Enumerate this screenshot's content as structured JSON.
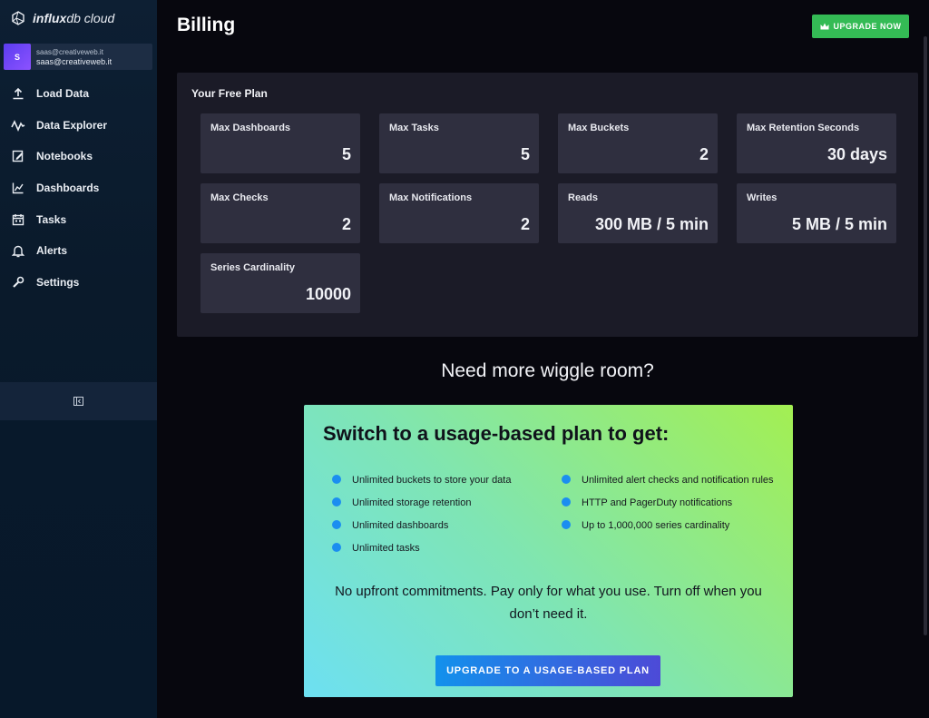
{
  "app": {
    "logo_text_bold": "influx",
    "logo_text_rest": "db cloud"
  },
  "user": {
    "avatar_letter": "S",
    "line1": "saas@creativeweb.it",
    "line2": "saas@creativeweb.it"
  },
  "sidebar": {
    "items": [
      {
        "label": "Load Data",
        "icon": "upload-icon"
      },
      {
        "label": "Data Explorer",
        "icon": "graph-icon"
      },
      {
        "label": "Notebooks",
        "icon": "notebook-icon"
      },
      {
        "label": "Dashboards",
        "icon": "dashboard-icon"
      },
      {
        "label": "Tasks",
        "icon": "calendar-icon"
      },
      {
        "label": "Alerts",
        "icon": "bell-icon"
      },
      {
        "label": "Settings",
        "icon": "wrench-icon"
      }
    ]
  },
  "header": {
    "title": "Billing",
    "upgrade_label": "UPGRADE NOW"
  },
  "plan": {
    "title": "Your Free Plan",
    "cards": [
      {
        "label": "Max Dashboards",
        "value": "5"
      },
      {
        "label": "Max Tasks",
        "value": "5"
      },
      {
        "label": "Max Buckets",
        "value": "2"
      },
      {
        "label": "Max Retention Seconds",
        "value": "30 days"
      },
      {
        "label": "Max Checks",
        "value": "2"
      },
      {
        "label": "Max Notifications",
        "value": "2"
      },
      {
        "label": "Reads",
        "value": "300 MB / 5 min"
      },
      {
        "label": "Writes",
        "value": "5 MB / 5 min"
      },
      {
        "label": "Series Cardinality",
        "value": "10000"
      }
    ]
  },
  "promo": {
    "heading": "Need more wiggle room?",
    "title": "Switch to a usage-based plan to get:",
    "features_left": [
      "Unlimited buckets to store your data",
      "Unlimited storage retention",
      "Unlimited dashboards",
      "Unlimited tasks"
    ],
    "features_right": [
      "Unlimited alert checks and notification rules",
      "HTTP and PagerDuty notifications",
      "Up to 1,000,000 series cardinality"
    ],
    "note": "No upfront commitments. Pay only for what you use. Turn off when you don’t need it.",
    "button_label": "UPGRADE TO A USAGE-BASED PLAN"
  },
  "colors": {
    "accent_green": "#34bb55",
    "accent_blue": "#1291ec",
    "bullet_blue": "#1b8ef0"
  }
}
